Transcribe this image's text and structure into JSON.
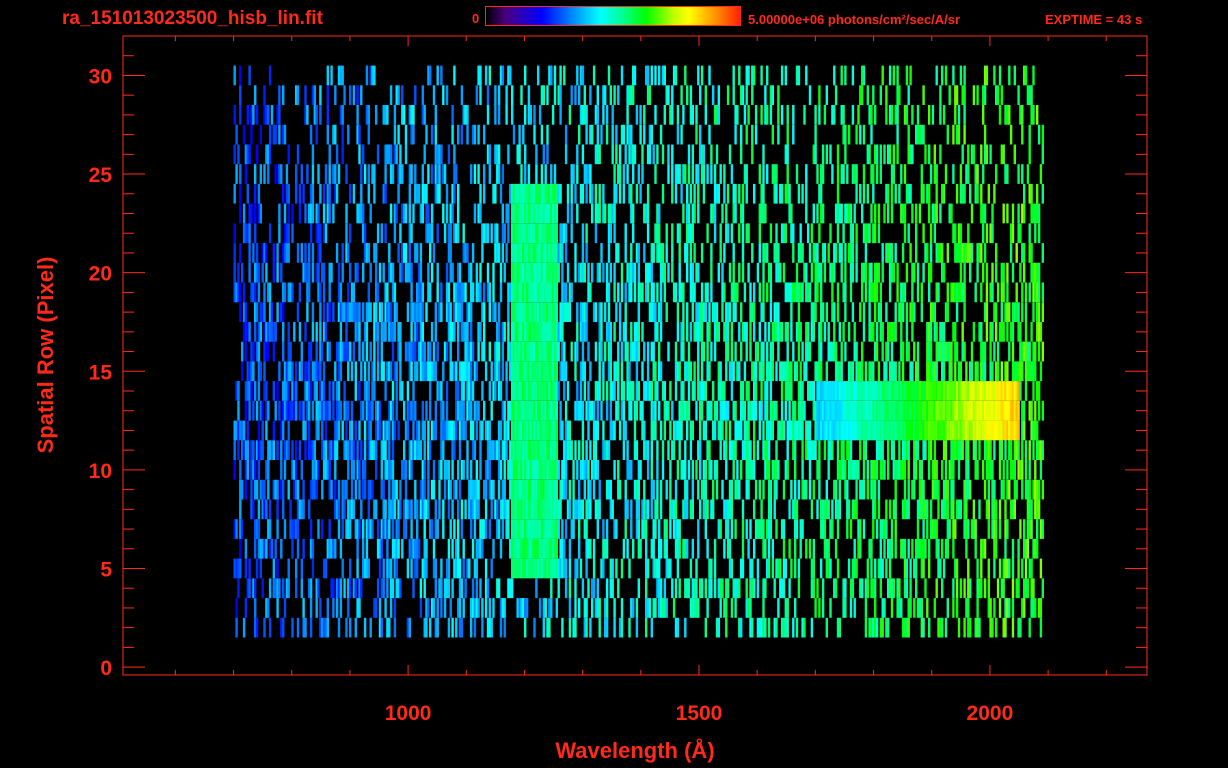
{
  "header": {
    "file_title": "ra_151013023500_hisb_lin.fit",
    "colorbar_min": "0",
    "colorbar_max": "5.00000e+06 photons/cm²/sec/A/sr",
    "exptime": "EXPTIME = 43 s"
  },
  "colors": {
    "axis": "#ff2a1a",
    "background": "#000000",
    "colormap": "rainbow (black-purple-blue-cyan-green-yellow-red)"
  },
  "chart_data": {
    "type": "heatmap",
    "xlabel": "Wavelength (Å)",
    "ylabel": "Spatial Row (Pixel)",
    "xlim": [
      510,
      2270
    ],
    "ylim": [
      -0.4,
      32
    ],
    "xticks": [
      1000,
      1500,
      2000
    ],
    "yticks": [
      0,
      5,
      10,
      15,
      20,
      25,
      30
    ],
    "colorbar_range": [
      0,
      5000000
    ],
    "colorbar_units": "photons/cm²/sec/A/sr",
    "data_extent": {
      "wavelength": [
        700,
        2090
      ],
      "row": [
        2,
        30
      ]
    },
    "features": [
      {
        "name": "Lyman-alpha line",
        "wavelength": 1216,
        "rows": [
          5,
          24
        ],
        "level": 0.55
      },
      {
        "name": "continuum stripe",
        "rows": [
          12,
          14
        ],
        "wavelength": [
          1700,
          2050
        ],
        "level_start": 0.4,
        "level_end": 0.85
      }
    ]
  }
}
